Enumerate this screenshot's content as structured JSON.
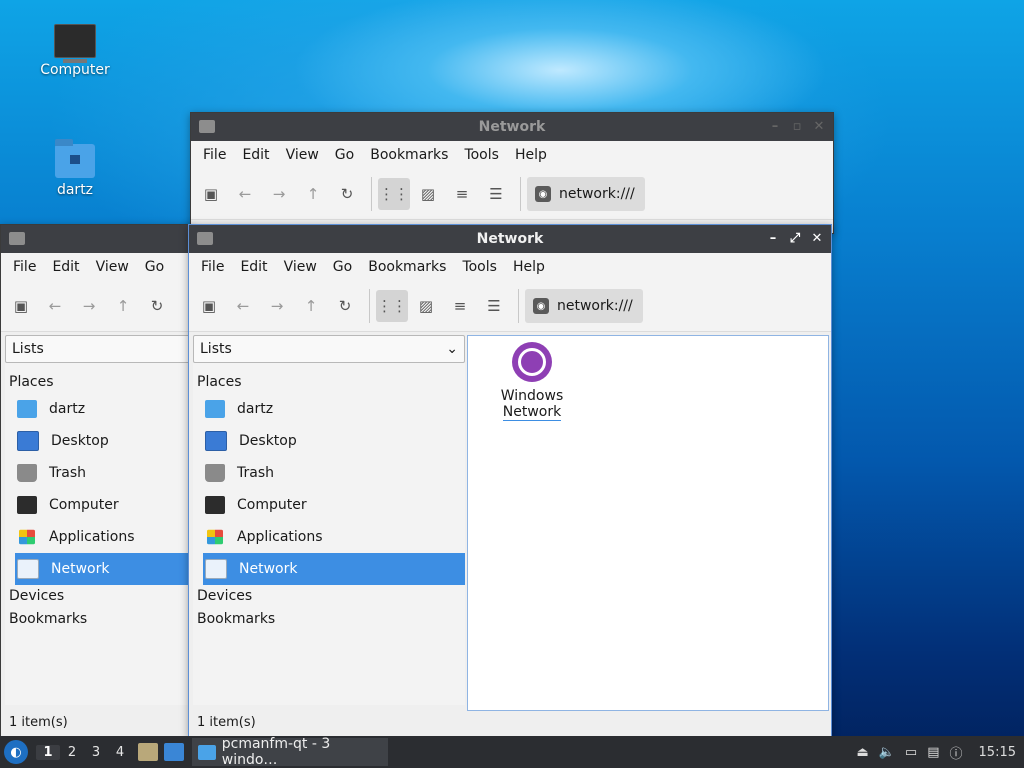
{
  "desktop": {
    "icons": [
      {
        "label": "Computer",
        "icon": "monitor-icon"
      },
      {
        "label": "dartz",
        "icon": "home-folder-icon"
      }
    ]
  },
  "windows": {
    "back": {
      "title": "Network",
      "menu": [
        "File",
        "Edit",
        "View",
        "Go",
        "Bookmarks",
        "Tools",
        "Help"
      ],
      "address": "network:///"
    },
    "left": {
      "menu": [
        "File",
        "Edit",
        "View",
        "Go"
      ],
      "side_combo": "Lists",
      "places_header": "Places",
      "places": [
        "dartz",
        "Desktop",
        "Trash",
        "Computer",
        "Applications",
        "Network"
      ],
      "devices": "Devices",
      "bookmarks": "Bookmarks",
      "status": "1 item(s)"
    },
    "front": {
      "title": "Network",
      "menu": [
        "File",
        "Edit",
        "View",
        "Go",
        "Bookmarks",
        "Tools",
        "Help"
      ],
      "address": "network:///",
      "side_combo": "Lists",
      "places_header": "Places",
      "places": [
        "dartz",
        "Desktop",
        "Trash",
        "Computer",
        "Applications",
        "Network"
      ],
      "selected_place": "Network",
      "devices": "Devices",
      "bookmarks": "Bookmarks",
      "status": "1 item(s)",
      "items": [
        {
          "label_line1": "Windows",
          "label_line2": "Network",
          "icon": "globe-icon"
        }
      ]
    }
  },
  "taskbar": {
    "workspaces": [
      "1",
      "2",
      "3",
      "4"
    ],
    "current_workspace": "1",
    "task_label": "pcmanfm-qt - 3 windo…",
    "clock": "15:15"
  },
  "colors": {
    "selection": "#3d8ee3",
    "titlebar": "#3d3f44",
    "taskbar": "#2b2d31",
    "network_icon": "#8e3fb4"
  }
}
